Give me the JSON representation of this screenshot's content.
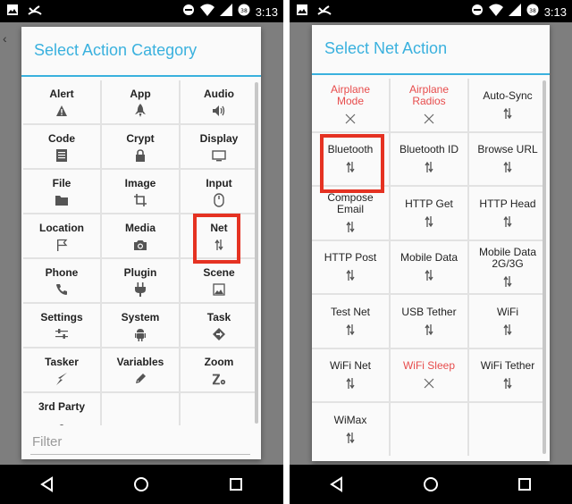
{
  "status_bar": {
    "time": "3:13"
  },
  "left_dialog": {
    "title": "Select Action Category",
    "categories": [
      {
        "label": "Alert",
        "icon": "warning-icon"
      },
      {
        "label": "App",
        "icon": "rocket-icon"
      },
      {
        "label": "Audio",
        "icon": "speaker-icon"
      },
      {
        "label": "Code",
        "icon": "document-lines-icon"
      },
      {
        "label": "Crypt",
        "icon": "lock-icon"
      },
      {
        "label": "Display",
        "icon": "monitor-icon"
      },
      {
        "label": "File",
        "icon": "folder-icon"
      },
      {
        "label": "Image",
        "icon": "crop-icon"
      },
      {
        "label": "Input",
        "icon": "mouse-icon"
      },
      {
        "label": "Location",
        "icon": "flag-icon"
      },
      {
        "label": "Media",
        "icon": "camera-icon"
      },
      {
        "label": "Net",
        "icon": "up-down-arrows-icon"
      },
      {
        "label": "Phone",
        "icon": "phone-icon"
      },
      {
        "label": "Plugin",
        "icon": "plug-icon"
      },
      {
        "label": "Scene",
        "icon": "picture-icon"
      },
      {
        "label": "Settings",
        "icon": "sliders-icon"
      },
      {
        "label": "System",
        "icon": "android-icon"
      },
      {
        "label": "Task",
        "icon": "diamond-arrow-icon"
      },
      {
        "label": "Tasker",
        "icon": "lightning-icon"
      },
      {
        "label": "Variables",
        "icon": "pencil-icon"
      },
      {
        "label": "Zoom",
        "icon": "zoom-gear-icon"
      },
      {
        "label": "3rd Party",
        "icon": "partial-icon"
      }
    ],
    "filter_placeholder": "Filter",
    "highlighted": "Net"
  },
  "right_dialog": {
    "title": "Select Net Action",
    "actions": [
      {
        "label": "Airplane\nMode",
        "disabled": true,
        "icon": "x-icon"
      },
      {
        "label": "Airplane\nRadios",
        "disabled": true,
        "icon": "x-icon"
      },
      {
        "label": "Auto-Sync",
        "disabled": false,
        "icon": "up-down-arrows-icon"
      },
      {
        "label": "Bluetooth",
        "disabled": false,
        "icon": "up-down-arrows-icon"
      },
      {
        "label": "Bluetooth ID",
        "disabled": false,
        "icon": "up-down-arrows-icon"
      },
      {
        "label": "Browse URL",
        "disabled": false,
        "icon": "up-down-arrows-icon"
      },
      {
        "label": "Compose\nEmail",
        "disabled": false,
        "icon": "up-down-arrows-icon"
      },
      {
        "label": "HTTP Get",
        "disabled": false,
        "icon": "up-down-arrows-icon"
      },
      {
        "label": "HTTP Head",
        "disabled": false,
        "icon": "up-down-arrows-icon"
      },
      {
        "label": "HTTP Post",
        "disabled": false,
        "icon": "up-down-arrows-icon"
      },
      {
        "label": "Mobile Data",
        "disabled": false,
        "icon": "up-down-arrows-icon"
      },
      {
        "label": "Mobile Data\n2G/3G",
        "disabled": false,
        "icon": "up-down-arrows-icon"
      },
      {
        "label": "Test Net",
        "disabled": false,
        "icon": "up-down-arrows-icon"
      },
      {
        "label": "USB Tether",
        "disabled": false,
        "icon": "up-down-arrows-icon"
      },
      {
        "label": "WiFi",
        "disabled": false,
        "icon": "up-down-arrows-icon"
      },
      {
        "label": "WiFi Net",
        "disabled": false,
        "icon": "up-down-arrows-icon"
      },
      {
        "label": "WiFi Sleep",
        "disabled": true,
        "icon": "x-icon"
      },
      {
        "label": "WiFi Tether",
        "disabled": false,
        "icon": "up-down-arrows-icon"
      },
      {
        "label": "WiMax",
        "disabled": false,
        "icon": "up-down-arrows-icon"
      }
    ],
    "highlighted": "Bluetooth"
  },
  "colors": {
    "accent": "#3ab1de",
    "highlight": "#e53222",
    "disabled_text": "#e74c4c"
  }
}
